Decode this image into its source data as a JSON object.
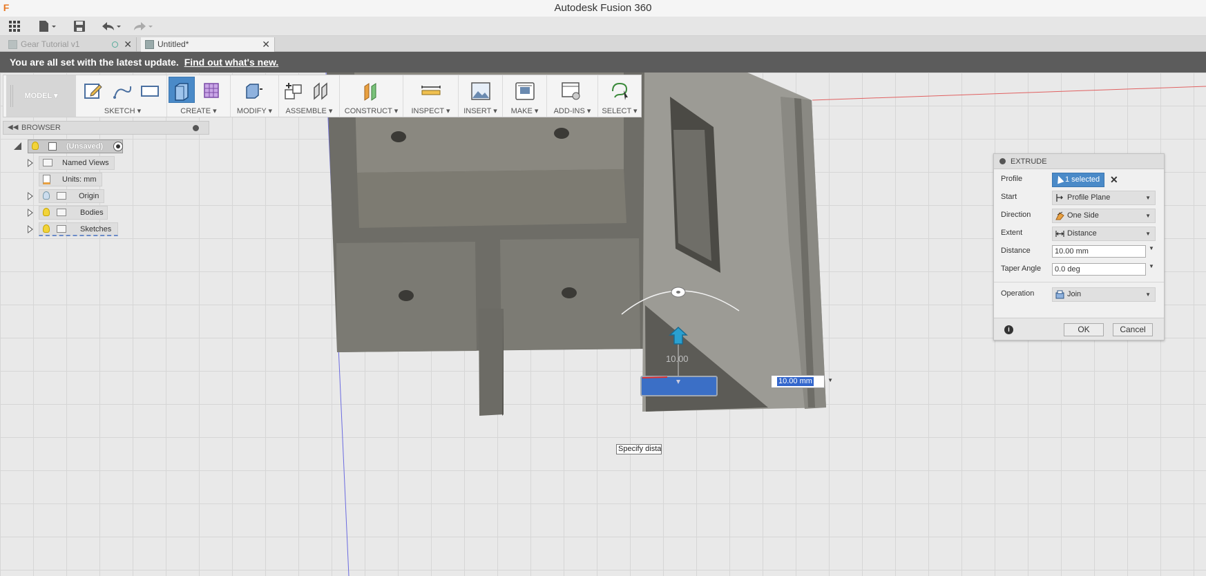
{
  "window": {
    "title": "Autodesk Fusion 360",
    "logo": "F"
  },
  "tabs": [
    {
      "label": "Gear Tutorial v1",
      "active": false
    },
    {
      "label": "Untitled*",
      "active": true
    }
  ],
  "banner": {
    "text": "You are all set with the latest update.",
    "link": "Find out what's new."
  },
  "ribbon": {
    "mode": "MODEL",
    "groups": [
      {
        "label": "SKETCH"
      },
      {
        "label": "CREATE"
      },
      {
        "label": "MODIFY"
      },
      {
        "label": "ASSEMBLE"
      },
      {
        "label": "CONSTRUCT"
      },
      {
        "label": "INSPECT"
      },
      {
        "label": "INSERT"
      },
      {
        "label": "MAKE"
      },
      {
        "label": "ADD-INS"
      },
      {
        "label": "SELECT"
      }
    ]
  },
  "browser": {
    "title": "BROWSER",
    "root": "(Unsaved)",
    "items": [
      {
        "label": "Named Views"
      },
      {
        "label": "Units: mm"
      },
      {
        "label": "Origin"
      },
      {
        "label": "Bodies"
      },
      {
        "label": "Sketches"
      }
    ]
  },
  "extrude": {
    "title": "EXTRUDE",
    "profile_label": "Profile",
    "profile_value": "1 selected",
    "start_label": "Start",
    "start_value": "Profile Plane",
    "direction_label": "Direction",
    "direction_value": "One Side",
    "extent_label": "Extent",
    "extent_value": "Distance",
    "distance_label": "Distance",
    "distance_value": "10.00 mm",
    "taper_label": "Taper Angle",
    "taper_value": "0.0 deg",
    "operation_label": "Operation",
    "operation_value": "Join",
    "ok_label": "OK",
    "cancel_label": "Cancel"
  },
  "canvas": {
    "distance_input": "10.00 mm",
    "dimension_label": "10.00",
    "tooltip": "Specify distar"
  },
  "colors": {
    "accent": "#4a8ac8",
    "banner": "#5c5c5c",
    "model": "#7c7b74"
  }
}
